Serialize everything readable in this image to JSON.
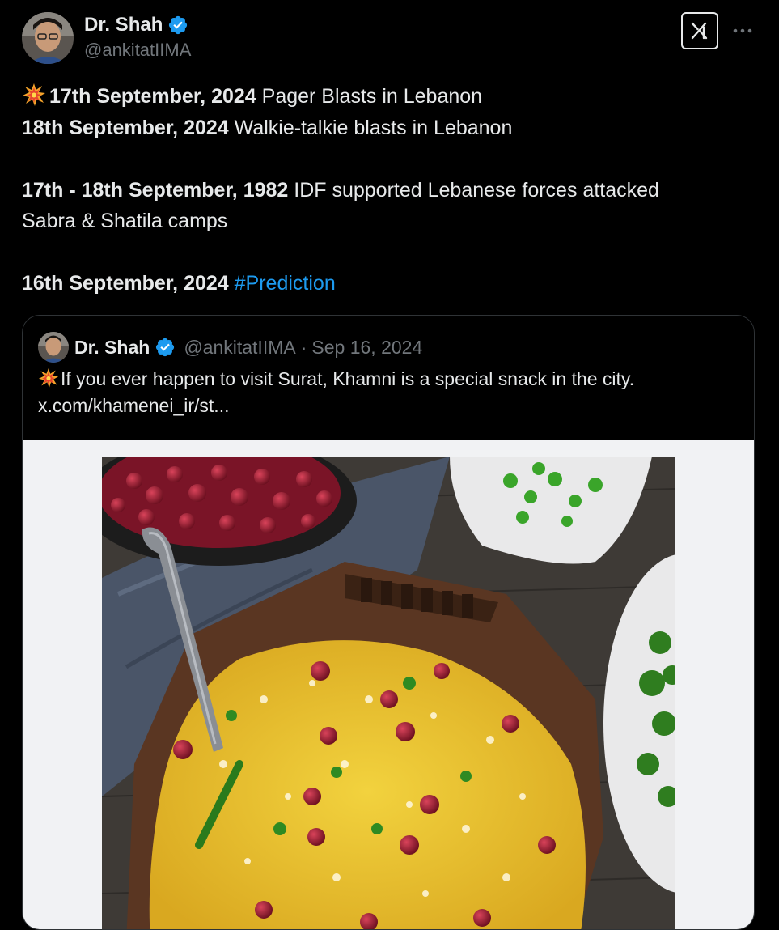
{
  "tweet": {
    "author": {
      "display_name": "Dr. Shah",
      "handle": "@ankitatIIMA",
      "verified": true
    },
    "icons": {
      "grok": "grok-icon",
      "more": "more-horizontal-icon",
      "verified": "verified-badge-icon",
      "emoji": "collision-emoji-icon"
    },
    "lines": [
      {
        "bold": "17th September, 2024",
        "text": " Pager Blasts in Lebanon"
      },
      {
        "bold": "18th September, 2024",
        "text": " Walkie-talkie blasts in Lebanon"
      },
      {
        "bold": "17th - 18th September, 1982",
        "text": " IDF supported Lebanese forces attacked"
      },
      {
        "text": "Sabra & Shatila camps"
      },
      {
        "bold": "16th September, 2024",
        "hashtag": "#Prediction"
      }
    ]
  },
  "quoted": {
    "display_name": "Dr. Shah",
    "handle": "@ankitatIIMA",
    "separator": "·",
    "date": "Sep 16, 2024",
    "text": "If you ever happen to visit Surat, Khamni is a special snack in the city.",
    "link": "x.com/khamenei_ir/st...",
    "media_alt": "Khamni snack in a carved wooden bowl with pomegranate seeds and green chilies"
  },
  "colors": {
    "background": "#000000",
    "text_primary": "#e7e9ea",
    "text_secondary": "#71767b",
    "accent": "#1d9bf0",
    "border": "#2f3336"
  }
}
